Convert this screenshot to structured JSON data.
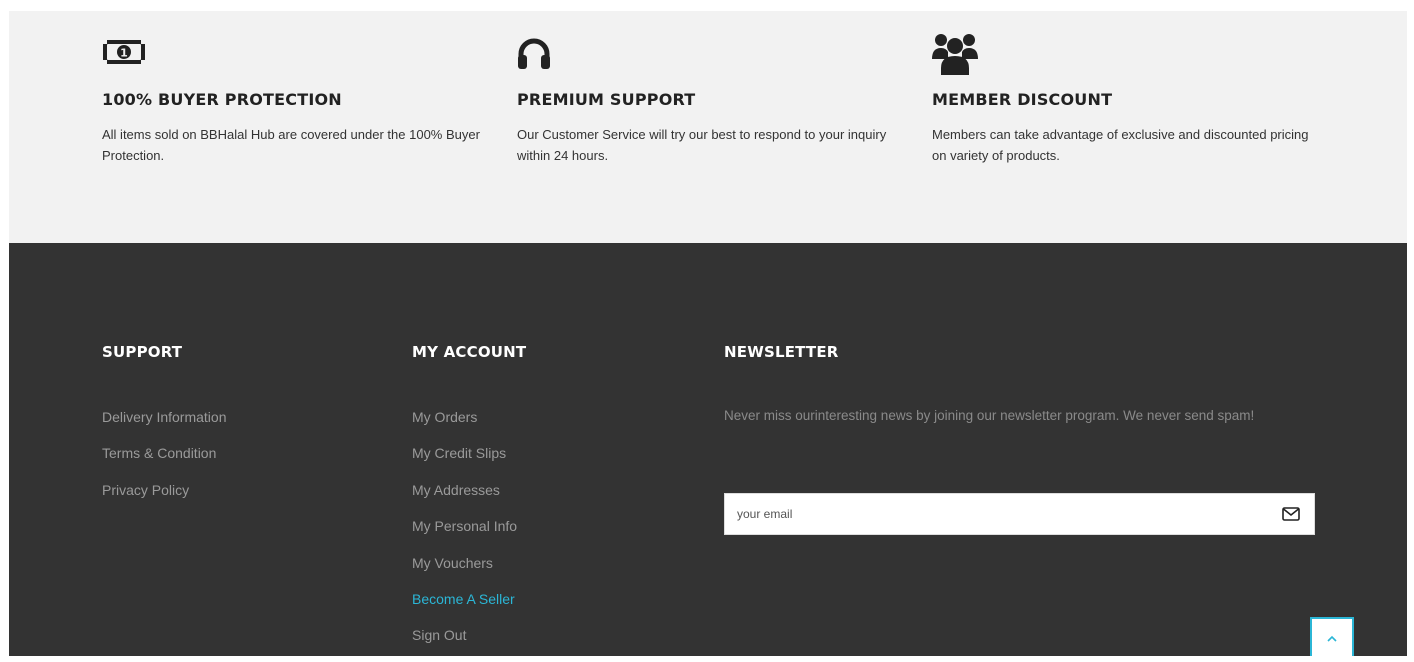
{
  "features": [
    {
      "icon": "money-icon",
      "title": "100% BUYER PROTECTION",
      "text": "All items sold on BBHalal Hub are covered under the 100% Buyer Protection."
    },
    {
      "icon": "headphones-icon",
      "title": "PREMIUM SUPPORT",
      "text": "Our Customer Service will try our best to respond to your inquiry within 24 hours."
    },
    {
      "icon": "users-icon",
      "title": "MEMBER DISCOUNT",
      "text": "Members can take advantage of exclusive and discounted pricing on variety of products."
    }
  ],
  "footer": {
    "support": {
      "title": "SUPPORT",
      "links": [
        "Delivery Information",
        "Terms & Condition",
        "Privacy Policy"
      ]
    },
    "account": {
      "title": "MY ACCOUNT",
      "links": [
        "My Orders",
        "My Credit Slips",
        "My Addresses",
        "My Personal Info",
        "My Vouchers",
        "Become A Seller",
        "Sign Out"
      ]
    },
    "newsletter": {
      "title": "NEWSLETTER",
      "text": "Never miss ourinteresting news by joining our newsletter program. We never send spam!",
      "placeholder": "your email",
      "submit_icon": "envelope-icon"
    }
  },
  "back_to_top_icon": "chevron-up-icon",
  "colors": {
    "accent": "#2bb6d6",
    "footer_bg": "#333333",
    "features_bg": "#f2f2f2"
  }
}
